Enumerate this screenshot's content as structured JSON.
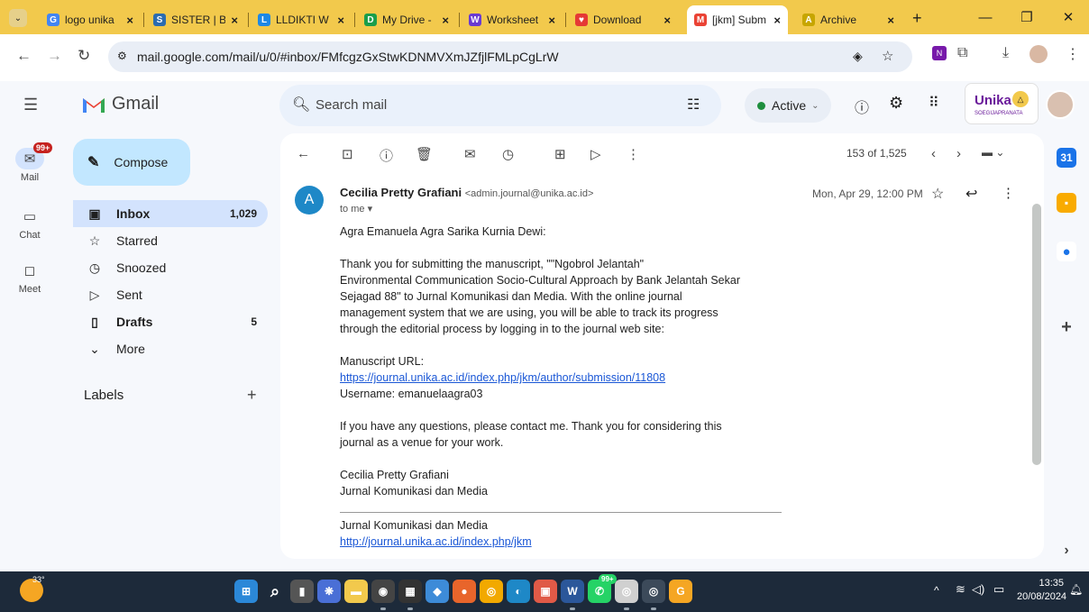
{
  "browser": {
    "tabs": [
      {
        "title": "logo unika",
        "favicon": "G",
        "color": "#4285f4"
      },
      {
        "title": "SISTER | Be",
        "favicon": "S",
        "color": "#2b6cb0"
      },
      {
        "title": "LLDIKTI W",
        "favicon": "L",
        "color": "#1e88e5"
      },
      {
        "title": "My Drive -",
        "favicon": "D",
        "color": "#1a9e4b"
      },
      {
        "title": "Worksheet",
        "favicon": "W",
        "color": "#6a3bd1"
      },
      {
        "title": "Download",
        "favicon": "♥",
        "color": "#e53935"
      },
      {
        "title": "[jkm] Subm",
        "favicon": "M",
        "color": "#ea4335"
      },
      {
        "title": "Archive",
        "favicon": "A",
        "color": "#c7a600"
      }
    ],
    "new_tab": "+",
    "url": "mail.google.com/mail/u/0/#inbox/FMfcgzGxStwKDNMVXmJZfjlFMLpCgLrW"
  },
  "gmail": {
    "brand": "Gmail",
    "search_placeholder": "Search mail",
    "status": "Active",
    "org_logo": "Unika",
    "org_sub": "SOEGIJAPRANATA",
    "rail": {
      "mail_badge": "99+",
      "mail": "Mail",
      "chat": "Chat",
      "meet": "Meet"
    },
    "compose": "Compose",
    "nav": [
      {
        "label": "Inbox",
        "count": "1,029",
        "icon": "inbox-icon",
        "glyph": "▣"
      },
      {
        "label": "Starred",
        "count": "",
        "icon": "star-icon",
        "glyph": "☆"
      },
      {
        "label": "Snoozed",
        "count": "",
        "icon": "clock-icon",
        "glyph": "◷"
      },
      {
        "label": "Sent",
        "count": "",
        "icon": "send-icon",
        "glyph": "▷"
      },
      {
        "label": "Drafts",
        "count": "5",
        "icon": "draft-icon",
        "glyph": "▯"
      },
      {
        "label": "More",
        "count": "",
        "icon": "chevron-down-icon",
        "glyph": "⌄"
      }
    ],
    "labels_heading": "Labels",
    "pagination": "153 of 1,525"
  },
  "email": {
    "avatar": "A",
    "sender_name": "Cecilia Pretty Grafiani",
    "sender_email": "<admin.journal@unika.ac.id>",
    "to": "to me",
    "date": "Mon, Apr 29, 12:00 PM",
    "greeting": "Agra Emanuela Agra Sarika Kurnia Dewi:",
    "para1_lines": [
      "Thank you for submitting the manuscript, \"\"Ngobrol Jelantah\"",
      "Environmental Communication Socio-Cultural Approach by Bank Jelantah Sekar",
      "Sejagad 88\" to Jurnal Komunikasi dan Media. With the online journal",
      "management system that we are using, you will be able to track its progress",
      "through the editorial process by logging in to the journal web site:"
    ],
    "manuscript_label": "Manuscript URL:",
    "manuscript_url": "https://journal.unika.ac.id/index.php/jkm/author/submission/11808",
    "username": "Username: emanuelaagra03",
    "para2_lines": [
      "If you have any questions, please contact me. Thank you for considering this",
      "journal as a venue for your work."
    ],
    "sig_name": "Cecilia Pretty Grafiani",
    "sig_org": "Jurnal Komunikasi dan Media",
    "footer_org": "Jurnal Komunikasi dan Media",
    "footer_url": "http://journal.unika.ac.id/index.php/jkm"
  },
  "taskbar": {
    "weather": "33°",
    "time": "13:35",
    "date": "20/08/2024",
    "badge": "99+"
  }
}
